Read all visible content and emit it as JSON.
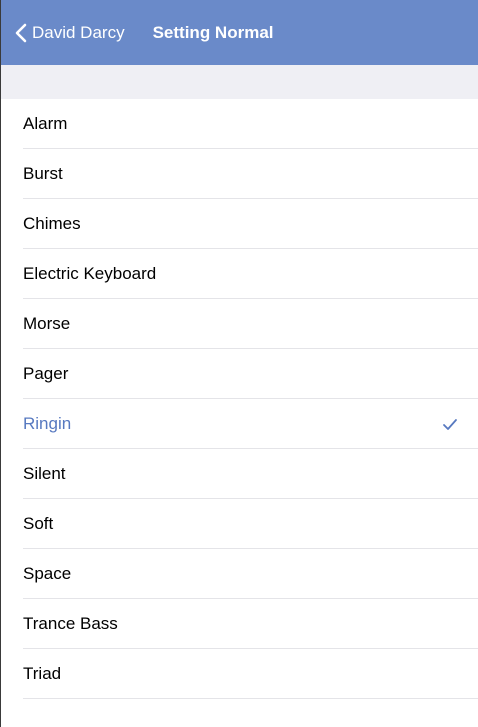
{
  "navbar": {
    "back_label": "David Darcy",
    "title": "Setting Normal",
    "color": "#6a8ac9"
  },
  "accent_color": "#5779c0",
  "tones": [
    {
      "label": "Alarm",
      "selected": false
    },
    {
      "label": "Burst",
      "selected": false
    },
    {
      "label": "Chimes",
      "selected": false
    },
    {
      "label": "Electric Keyboard",
      "selected": false
    },
    {
      "label": "Morse",
      "selected": false
    },
    {
      "label": "Pager",
      "selected": false
    },
    {
      "label": "Ringin",
      "selected": true
    },
    {
      "label": "Silent",
      "selected": false
    },
    {
      "label": "Soft",
      "selected": false
    },
    {
      "label": "Space",
      "selected": false
    },
    {
      "label": "Trance Bass",
      "selected": false
    },
    {
      "label": "Triad",
      "selected": false
    }
  ],
  "icons": {
    "back": "chevron-left-icon",
    "selected": "checkmark-icon"
  }
}
